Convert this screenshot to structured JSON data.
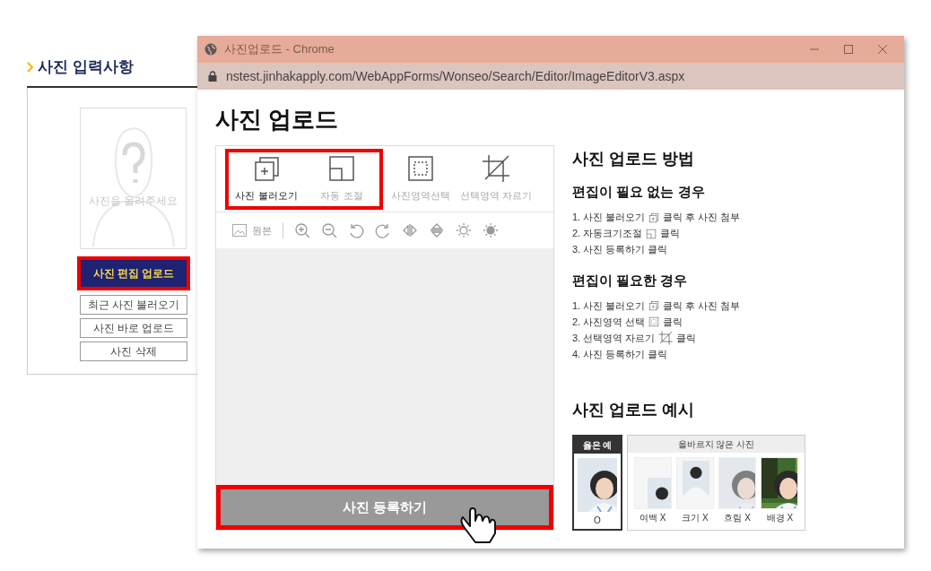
{
  "side_panel": {
    "title": "사진 입력사항",
    "photo_placeholder": "사진을 올려주세요",
    "buttons": [
      {
        "label": "사진 편집 업로드",
        "highlighted": true
      },
      {
        "label": "최근 사진 불러오기",
        "highlighted": false
      },
      {
        "label": "사진 바로 업로드",
        "highlighted": false
      },
      {
        "label": "사진 삭제",
        "highlighted": false
      }
    ]
  },
  "window": {
    "title": "사진업로드 - Chrome",
    "url": "nstest.jinhakapply.com/WebAppForms/Wonseo/Search/Editor/ImageEditorV3.aspx"
  },
  "page_title": "사진 업로드",
  "editor": {
    "tools": [
      {
        "label": "사진 불러오기",
        "kind": "load",
        "disabled": false,
        "highlighted": true
      },
      {
        "label": "자동 조절",
        "kind": "autosize",
        "disabled": true,
        "highlighted": true
      },
      {
        "label": "사진영역선택",
        "kind": "select",
        "disabled": true,
        "highlighted": false
      },
      {
        "label": "선택영역 자르기",
        "kind": "crop",
        "disabled": true,
        "highlighted": false
      }
    ],
    "original_label": "원본",
    "register_button": {
      "label": "사진 등록하기",
      "highlighted": true
    }
  },
  "guide": {
    "title": "사진 업로드 방법",
    "sections": [
      {
        "title": "편집이 필요 없는 경우",
        "steps": [
          {
            "text": "1. 사진 불러오기",
            "kind": "load",
            "after": "클릭 후 사진 첨부"
          },
          {
            "text": "2. 자동크기조절",
            "kind": "autosize",
            "after": "클릭"
          },
          {
            "text": "3. 사진 등록하기 클릭"
          }
        ]
      },
      {
        "title": "편집이 필요한 경우",
        "steps": [
          {
            "text": "1. 사진 불러오기",
            "kind": "load",
            "after": "클릭 후 사진 첨부"
          },
          {
            "text": "2. 사진영역 선택",
            "kind": "select",
            "after": "클릭"
          },
          {
            "text": "3. 선택영역 자르기",
            "kind": "crop",
            "after": "클릭"
          },
          {
            "text": "4. 사진 등록하기 클릭"
          }
        ]
      }
    ]
  },
  "examples": {
    "title": "사진 업로드 예시",
    "good_header": "옳은 예",
    "bad_header": "올바르지 않은 사진",
    "good": {
      "kind": "good",
      "caption": "O"
    },
    "bad": [
      {
        "kind": "margin",
        "caption": "여백 X"
      },
      {
        "kind": "size",
        "caption": "크기 X"
      },
      {
        "kind": "blur",
        "caption": "흐림 X"
      },
      {
        "kind": "background",
        "caption": "배경 X"
      }
    ]
  }
}
